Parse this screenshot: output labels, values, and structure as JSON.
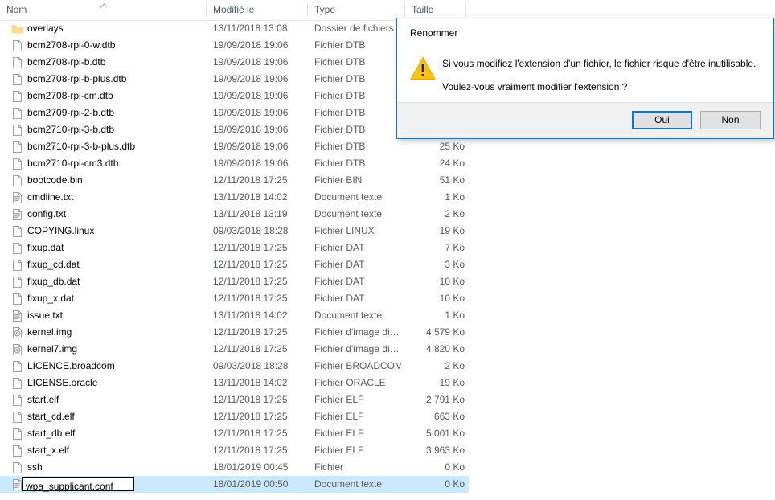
{
  "file_list": {
    "columns": [
      {
        "key": "name",
        "label": "Nom",
        "sorted": true,
        "sort_direction": "ascending"
      },
      {
        "key": "date",
        "label": "Modifié le",
        "sorted": false,
        "sort_direction": ""
      },
      {
        "key": "type",
        "label": "Type",
        "sorted": false,
        "sort_direction": ""
      },
      {
        "key": "size",
        "label": "Taille",
        "sorted": false,
        "sort_direction": ""
      }
    ],
    "sort_indicator_icon": "chevron-up-icon",
    "rows": [
      {
        "name": "overlays",
        "icon": "folder-icon",
        "date": "13/11/2018 13:08",
        "type": "Dossier de fichiers",
        "size": "",
        "selected": false,
        "editing": false
      },
      {
        "name": "bcm2708-rpi-0-w.dtb",
        "icon": "file-icon",
        "date": "19/09/2018 19:06",
        "type": "Fichier DTB",
        "size": "",
        "selected": false,
        "editing": false
      },
      {
        "name": "bcm2708-rpi-b.dtb",
        "icon": "file-icon",
        "date": "19/09/2018 19:06",
        "type": "Fichier DTB",
        "size": "",
        "selected": false,
        "editing": false
      },
      {
        "name": "bcm2708-rpi-b-plus.dtb",
        "icon": "file-icon",
        "date": "19/09/2018 19:06",
        "type": "Fichier DTB",
        "size": "",
        "selected": false,
        "editing": false
      },
      {
        "name": "bcm2708-rpi-cm.dtb",
        "icon": "file-icon",
        "date": "19/09/2018 19:06",
        "type": "Fichier DTB",
        "size": "",
        "selected": false,
        "editing": false
      },
      {
        "name": "bcm2709-rpi-2-b.dtb",
        "icon": "file-icon",
        "date": "19/09/2018 19:06",
        "type": "Fichier DTB",
        "size": "",
        "selected": false,
        "editing": false
      },
      {
        "name": "bcm2710-rpi-3-b.dtb",
        "icon": "file-icon",
        "date": "19/09/2018 19:06",
        "type": "Fichier DTB",
        "size": "",
        "selected": false,
        "editing": false
      },
      {
        "name": "bcm2710-rpi-3-b-plus.dtb",
        "icon": "file-icon",
        "date": "19/09/2018 19:06",
        "type": "Fichier DTB",
        "size": "25 Ko",
        "selected": false,
        "editing": false
      },
      {
        "name": "bcm2710-rpi-cm3.dtb",
        "icon": "file-icon",
        "date": "19/09/2018 19:06",
        "type": "Fichier DTB",
        "size": "24 Ko",
        "selected": false,
        "editing": false
      },
      {
        "name": "bootcode.bin",
        "icon": "file-icon",
        "date": "12/11/2018 17:25",
        "type": "Fichier BIN",
        "size": "51 Ko",
        "selected": false,
        "editing": false
      },
      {
        "name": "cmdline.txt",
        "icon": "text-file-icon",
        "date": "13/11/2018 14:02",
        "type": "Document texte",
        "size": "1 Ko",
        "selected": false,
        "editing": false
      },
      {
        "name": "config.txt",
        "icon": "text-file-icon",
        "date": "13/11/2018 13:19",
        "type": "Document texte",
        "size": "2 Ko",
        "selected": false,
        "editing": false
      },
      {
        "name": "COPYING.linux",
        "icon": "file-icon",
        "date": "09/03/2018 18:28",
        "type": "Fichier LINUX",
        "size": "19 Ko",
        "selected": false,
        "editing": false
      },
      {
        "name": "fixup.dat",
        "icon": "file-icon",
        "date": "12/11/2018 17:25",
        "type": "Fichier DAT",
        "size": "7 Ko",
        "selected": false,
        "editing": false
      },
      {
        "name": "fixup_cd.dat",
        "icon": "file-icon",
        "date": "12/11/2018 17:25",
        "type": "Fichier DAT",
        "size": "3 Ko",
        "selected": false,
        "editing": false
      },
      {
        "name": "fixup_db.dat",
        "icon": "file-icon",
        "date": "12/11/2018 17:25",
        "type": "Fichier DAT",
        "size": "10 Ko",
        "selected": false,
        "editing": false
      },
      {
        "name": "fixup_x.dat",
        "icon": "file-icon",
        "date": "12/11/2018 17:25",
        "type": "Fichier DAT",
        "size": "10 Ko",
        "selected": false,
        "editing": false
      },
      {
        "name": "issue.txt",
        "icon": "text-file-icon",
        "date": "13/11/2018 14:02",
        "type": "Document texte",
        "size": "1 Ko",
        "selected": false,
        "editing": false
      },
      {
        "name": "kernel.img",
        "icon": "disc-image-icon",
        "date": "12/11/2018 17:25",
        "type": "Fichier d'image di…",
        "size": "4 579 Ko",
        "selected": false,
        "editing": false
      },
      {
        "name": "kernel7.img",
        "icon": "disc-image-icon",
        "date": "12/11/2018 17:25",
        "type": "Fichier d'image di…",
        "size": "4 820 Ko",
        "selected": false,
        "editing": false
      },
      {
        "name": "LICENCE.broadcom",
        "icon": "file-icon",
        "date": "09/03/2018 18:28",
        "type": "Fichier BROADCOM",
        "size": "2 Ko",
        "selected": false,
        "editing": false
      },
      {
        "name": "LICENSE.oracle",
        "icon": "file-icon",
        "date": "13/11/2018 14:02",
        "type": "Fichier ORACLE",
        "size": "19 Ko",
        "selected": false,
        "editing": false
      },
      {
        "name": "start.elf",
        "icon": "file-icon",
        "date": "12/11/2018 17:25",
        "type": "Fichier ELF",
        "size": "2 791 Ko",
        "selected": false,
        "editing": false
      },
      {
        "name": "start_cd.elf",
        "icon": "file-icon",
        "date": "12/11/2018 17:25",
        "type": "Fichier ELF",
        "size": "663 Ko",
        "selected": false,
        "editing": false
      },
      {
        "name": "start_db.elf",
        "icon": "file-icon",
        "date": "12/11/2018 17:25",
        "type": "Fichier ELF",
        "size": "5 001 Ko",
        "selected": false,
        "editing": false
      },
      {
        "name": "start_x.elf",
        "icon": "file-icon",
        "date": "12/11/2018 17:25",
        "type": "Fichier ELF",
        "size": "3 963 Ko",
        "selected": false,
        "editing": false
      },
      {
        "name": "ssh",
        "icon": "file-icon",
        "date": "18/01/2019 00:45",
        "type": "Fichier",
        "size": "0 Ko",
        "selected": false,
        "editing": false
      },
      {
        "name": "wpa_supplicant.conf",
        "icon": "text-file-icon",
        "date": "18/01/2019 00:50",
        "type": "Document texte",
        "size": "0 Ko",
        "selected": true,
        "editing": true
      }
    ],
    "rename_input_value": "wpa_supplicant.conf"
  },
  "dialog": {
    "title": "Renommer",
    "warning_icon": "warning-triangle-icon",
    "message_line1": "Si vous modifiez l'extension d'un fichier, le fichier risque d'être inutilisable.",
    "message_line2": "Voulez-vous vraiment modifier l'extension ?",
    "confirm_label": "Oui",
    "cancel_label": "Non",
    "default_button": "Oui"
  },
  "colors": {
    "accent": "#0078d7",
    "selection": "#cce8ff",
    "warning": "#ffc20e",
    "folder": "#ffd071",
    "button_face": "#e1e1e1",
    "dialog_footer": "#f0f0f0",
    "header_text": "#4a5560",
    "secondary_text": "#555a60"
  }
}
